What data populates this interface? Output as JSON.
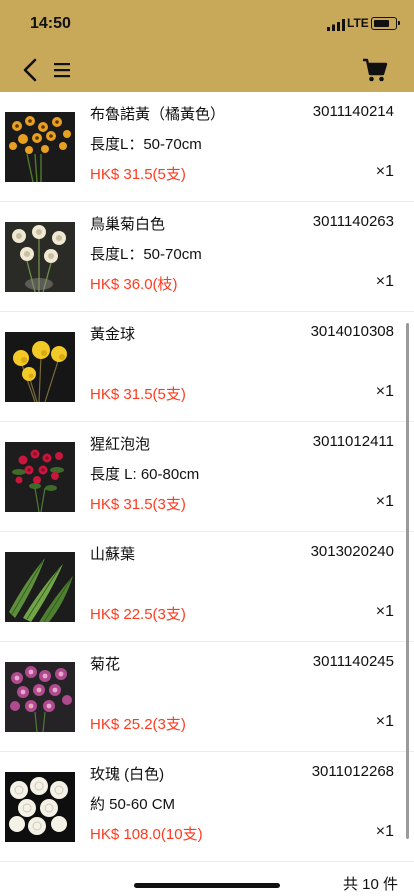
{
  "status_bar": {
    "time": "14:50",
    "network": "LTE"
  },
  "nav": {
    "back_icon": "chevron-left-icon",
    "menu_icon": "hamburger-menu-icon",
    "cart_icon": "shopping-cart-icon"
  },
  "items": [
    {
      "name": "布魯諾黃（橘黃色）",
      "code": "3011140214",
      "spec": "長度L：50-70cm",
      "price": "HK$ 31.5(5支)",
      "qty": "×1"
    },
    {
      "name": "鳥巢菊白色",
      "code": "3011140263",
      "spec": "長度L：50-70cm",
      "price": "HK$ 36.0(枝)",
      "qty": "×1"
    },
    {
      "name": "黃金球",
      "code": "3014010308",
      "spec": "",
      "price": "HK$ 31.5(5支)",
      "qty": "×1"
    },
    {
      "name": "猩紅泡泡",
      "code": "3011012411",
      "spec": "長度 L: 60-80cm",
      "price": "HK$ 31.5(3支)",
      "qty": "×1"
    },
    {
      "name": "山蘇葉",
      "code": "3013020240",
      "spec": "",
      "price": "HK$ 22.5(3支)",
      "qty": "×1"
    },
    {
      "name": "菊花",
      "code": "3011140245",
      "spec": "",
      "price": "HK$ 25.2(3支)",
      "qty": "×1"
    },
    {
      "name": "玫瑰 (白色)",
      "code": "3011012268",
      "spec": "約 50-60 CM",
      "price": "HK$ 108.0(10支)",
      "qty": "×1"
    }
  ],
  "footer": {
    "total": "共 10 件"
  },
  "colors": {
    "header_bg": "#c8a95a",
    "price": "#ff3b1f",
    "text": "#111111"
  }
}
